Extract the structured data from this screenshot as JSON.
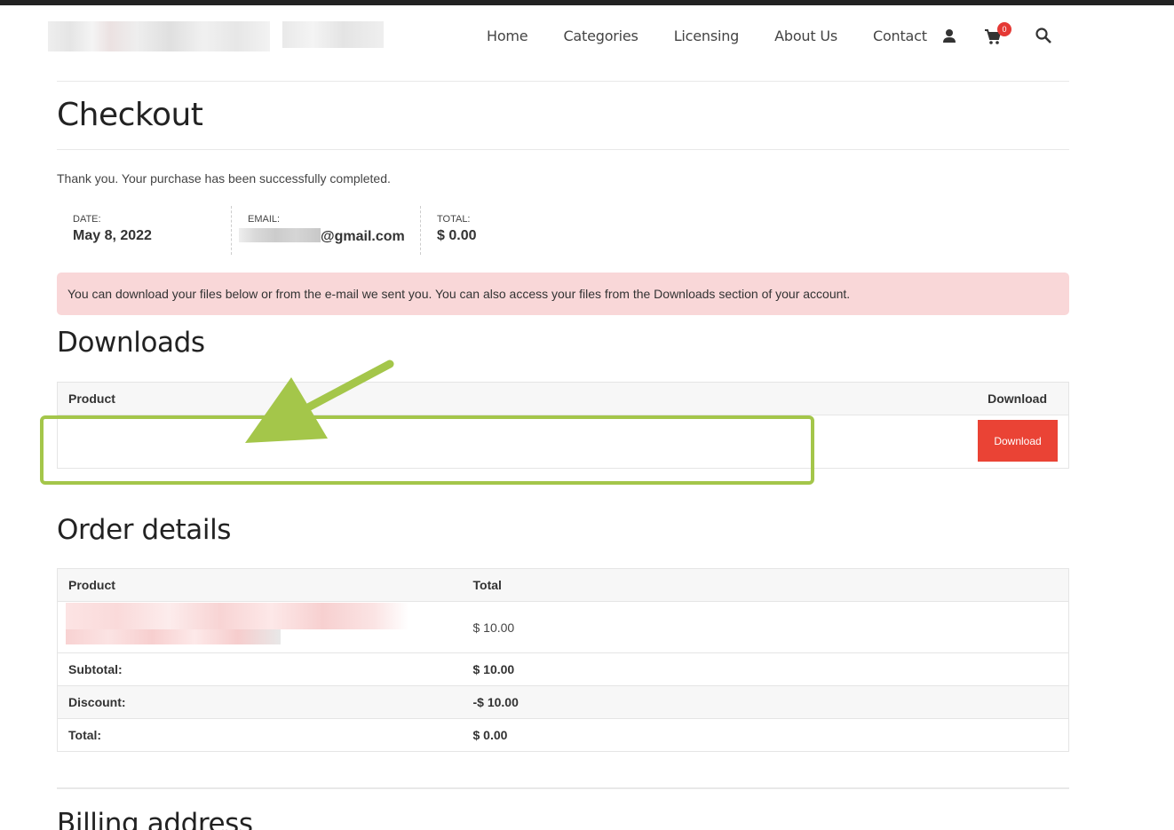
{
  "nav": {
    "items": [
      "Home",
      "Categories",
      "Licensing",
      "About Us",
      "Contact"
    ],
    "cart_count": "0",
    "icons": [
      "user-icon",
      "cart-icon",
      "search-icon"
    ]
  },
  "page_title": "Checkout",
  "thanks_text": "Thank you. Your purchase has been successfully completed.",
  "order_meta": {
    "date_label": "DATE:",
    "date_value": "May 8, 2022",
    "email_label": "EMAIL:",
    "email_suffix": "@gmail.com",
    "total_label": "TOTAL:",
    "total_value": "$ 0.00"
  },
  "notice": "You can download your files below or from the e-mail we sent you. You can also access your files from the Downloads section of your account.",
  "downloads": {
    "heading": "Downloads",
    "col_product": "Product",
    "col_download": "Download",
    "button_label": "Download"
  },
  "order_details": {
    "heading": "Order details",
    "col_product": "Product",
    "col_total": "Total",
    "item_total": "$ 10.00",
    "rows": [
      {
        "label": "Subtotal:",
        "value": "$ 10.00"
      },
      {
        "label": "Discount:",
        "value": "-$ 10.00"
      },
      {
        "label": "Total:",
        "value": "$ 0.00"
      }
    ]
  },
  "billing_heading": "Billing address",
  "colors": {
    "accent": "#ea4335",
    "notice_bg": "#f9d7d8",
    "annotation_green": "#a4c64a"
  }
}
